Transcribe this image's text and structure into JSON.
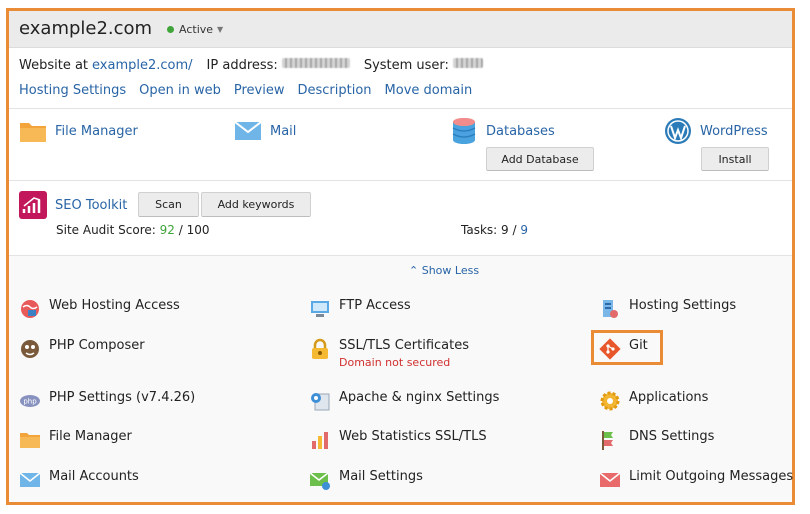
{
  "header": {
    "title": "example2.com",
    "status": "Active"
  },
  "info": {
    "website_label": "Website at",
    "website_link": "example2.com/",
    "ip_label": "IP address:",
    "user_label": "System user:"
  },
  "links": [
    "Hosting Settings",
    "Open in web",
    "Preview",
    "Description",
    "Move domain"
  ],
  "tools": {
    "file_manager": "File Manager",
    "mail": "Mail",
    "databases": "Databases",
    "add_database": "Add Database",
    "wordpress": "WordPress",
    "install": "Install"
  },
  "seo": {
    "label": "SEO Toolkit",
    "scan": "Scan",
    "add_keywords": "Add keywords",
    "audit_label": "Site Audit Score:",
    "score": "92",
    "score_sep": " / ",
    "score_max": "100",
    "tasks_label": "Tasks:",
    "tasks_done": "9",
    "tasks_sep": " / ",
    "tasks_total": "9"
  },
  "show_less": "Show Less",
  "grid": {
    "web_hosting_access": "Web Hosting Access",
    "ftp_access": "FTP Access",
    "hosting_settings": "Hosting Settings",
    "php_composer": "PHP Composer",
    "ssl_tls": "SSL/TLS Certificates",
    "ssl_status": "Domain not secured",
    "git": "Git",
    "php_settings": "PHP Settings (v7.4.26)",
    "apache_nginx": "Apache & nginx Settings",
    "applications": "Applications",
    "file_manager": "File Manager",
    "web_stats": "Web Statistics SSL/TLS",
    "dns_settings": "DNS Settings",
    "mail_accounts": "Mail Accounts",
    "mail_settings": "Mail Settings",
    "limit_outgoing": "Limit Outgoing Messages"
  },
  "colors": {
    "accent_orange": "#ea8b35",
    "link_blue": "#2864a6",
    "status_green": "#3fa43a",
    "error_red": "#d0302f"
  }
}
